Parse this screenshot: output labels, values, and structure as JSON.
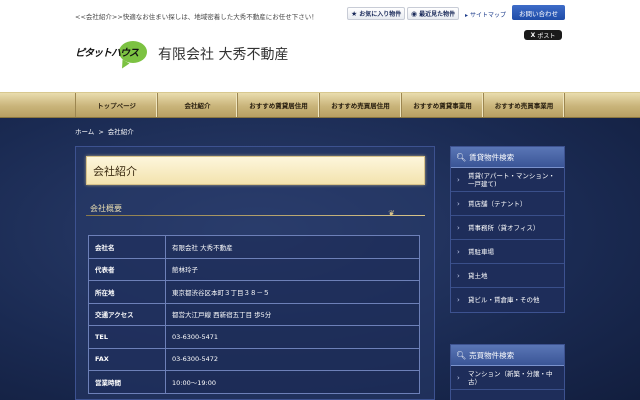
{
  "header": {
    "tagline": "<<会社紹介>>快適なお住まい探しは、地域密着した大秀不動産にお任せ下さい！",
    "favorites_label": "お気に入り物件",
    "recent_label": "最近見た物件",
    "sitemap_label": "サイトマップ",
    "contact_label": "お問い合わせ",
    "x_post_label": "ポスト",
    "logo_text": "ピタットハウス",
    "company_name": "有限会社 大秀不動産"
  },
  "nav": {
    "items": [
      {
        "label": "トップページ"
      },
      {
        "label": "会社紹介"
      },
      {
        "label": "おすすめ賃貸居住用"
      },
      {
        "label": "おすすめ売買居住用"
      },
      {
        "label": "おすすめ賃貸事業用"
      },
      {
        "label": "おすすめ売買事業用"
      }
    ]
  },
  "breadcrumb": {
    "home": "ホーム",
    "separator": ">",
    "current": "会社紹介"
  },
  "main": {
    "page_title": "会社紹介",
    "section_title": "会社概要",
    "rows": [
      {
        "key": "会社名",
        "value": "有限会社 大秀不動産"
      },
      {
        "key": "代表者",
        "value": "館林玲子"
      },
      {
        "key": "所在地",
        "value": "東京都渋谷区本町３丁目３８－５"
      },
      {
        "key": "交通アクセス",
        "value": "都営大江戸線 西新宿五丁目 歩5分"
      },
      {
        "key": "TEL",
        "value": "03-6300-5471"
      },
      {
        "key": "FAX",
        "value": "03-6300-5472"
      },
      {
        "key": "営業時間",
        "value": "10:00～19:00"
      }
    ]
  },
  "sidebar": {
    "rental_search": {
      "title": "賃貸物件検索",
      "items": [
        {
          "label": "賃貸(アパート・マンション・一戸建て)"
        },
        {
          "label": "賃店舗（テナント）"
        },
        {
          "label": "賃事務所（貸オフィス）"
        },
        {
          "label": "賃駐車場"
        },
        {
          "label": "貸土地"
        },
        {
          "label": "貸ビル・賃倉庫・その他"
        }
      ]
    },
    "sale_search": {
      "title": "売買物件検索",
      "items": [
        {
          "label": "マンション（新築・分譲・中古）"
        }
      ]
    }
  },
  "icons": {
    "favorites": "star-icon",
    "recent": "eye-icon",
    "sitemap": "arrow-right-icon",
    "search": "magnifier-icon",
    "chevron": "chevron-right-icon"
  },
  "colors": {
    "accent_blue": "#1f4ca8",
    "nav_gold": "#c9b47a",
    "body_navy": "#1a2a52",
    "logo_green": "#7cc242"
  }
}
